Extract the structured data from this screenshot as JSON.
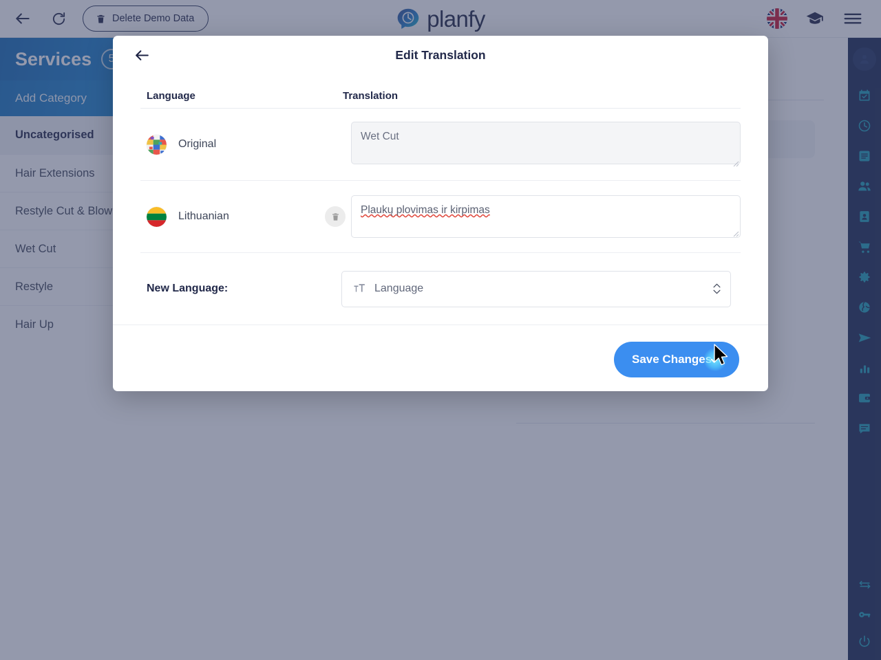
{
  "topbar": {
    "back_icon": "arrow-left-icon",
    "reload_icon": "reload-icon",
    "delete_demo_label": "Delete Demo Data",
    "delete_demo_icon": "trash-icon",
    "brand_name": "planfy",
    "brand_logo_icon": "planfy-speech-clock-logo",
    "language_flag_icon": "uk-flag-icon",
    "academy_icon": "graduation-cap-icon",
    "menu_icon": "hamburger-menu-icon"
  },
  "services_panel": {
    "title": "Services",
    "count": "5",
    "add_category_label": "Add Category",
    "categories": [
      {
        "label": "Uncategorised",
        "active": true
      },
      {
        "label": "Hair Extensions",
        "active": false
      },
      {
        "label": "Restyle Cut & Blow Dry",
        "active": false
      },
      {
        "label": "Wet Cut",
        "active": false
      },
      {
        "label": "Restyle",
        "active": false
      },
      {
        "label": "Hair Up",
        "active": false
      }
    ]
  },
  "content_stub": {
    "info_icon": "info-circle-icon"
  },
  "rail": {
    "avatar_icon": "user-avatar-icon",
    "items": [
      {
        "icon": "calendar-check-icon"
      },
      {
        "icon": "clock-icon"
      },
      {
        "icon": "list-icon"
      },
      {
        "icon": "users-icon"
      },
      {
        "icon": "contact-card-icon"
      },
      {
        "icon": "shopping-cart-icon"
      },
      {
        "icon": "gear-icon"
      },
      {
        "icon": "globe-icon"
      },
      {
        "icon": "send-icon"
      },
      {
        "icon": "bar-chart-icon"
      },
      {
        "icon": "wallet-icon"
      },
      {
        "icon": "chat-icon"
      }
    ],
    "bottom_items": [
      {
        "icon": "swap-arrows-icon"
      },
      {
        "icon": "key-icon"
      },
      {
        "icon": "power-icon"
      }
    ]
  },
  "modal": {
    "back_icon": "arrow-left-icon",
    "title": "Edit Translation",
    "columns": {
      "language": "Language",
      "translation": "Translation"
    },
    "rows": [
      {
        "flag_icon": "world-flags-mosaic-icon",
        "language": "Original",
        "translation_value": "Wet Cut",
        "readonly": true,
        "deletable": false,
        "spellcheck_error": false
      },
      {
        "flag_icon": "lithuania-flag-icon",
        "language": "Lithuanian",
        "translation_value": "Plaukų plovimas ir kirpimas",
        "readonly": false,
        "deletable": true,
        "delete_icon": "trash-icon",
        "spellcheck_error": true
      }
    ],
    "new_language": {
      "label": "New Language:",
      "field_icon": "text-size-icon",
      "placeholder": "Language",
      "selected_value": "",
      "stepper_icon": "chevron-up-down-icon"
    },
    "save_label": "Save Changes",
    "save_state_icon": "check-circle-icon",
    "cursor_icon": "mouse-cursor-icon"
  },
  "colors": {
    "brand_dark": "#1b2240",
    "accent_blue": "#3b8ef0",
    "panel_gradient_start": "#1268b3",
    "panel_gradient_end": "#2093e0",
    "rail_bg": "#15254f",
    "rail_icon": "#1a9cb5",
    "overlay": "rgba(61,70,103,0.55)",
    "spellcheck_underline": "#e04a3f",
    "check_glow": "#78ebff"
  }
}
